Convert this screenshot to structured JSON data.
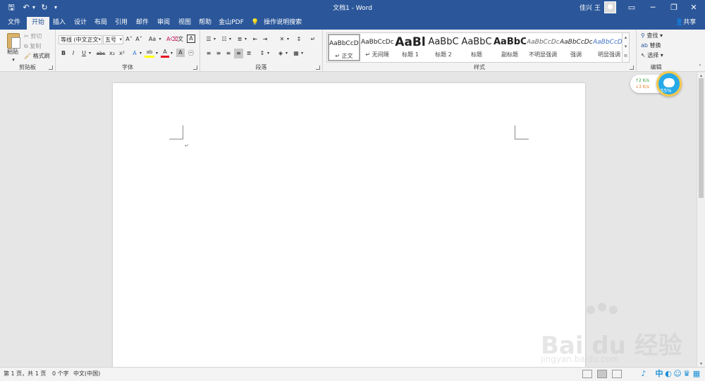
{
  "window": {
    "title": "文档1 - Word",
    "user": "佳兴 王",
    "qat": {
      "save": "🖫",
      "undo": "↶",
      "redo": "↻",
      "customize": "▾"
    },
    "controls": {
      "display_options": "▭",
      "minimize": "─",
      "restore": "❐",
      "close": "✕"
    }
  },
  "tabs": [
    "文件",
    "开始",
    "插入",
    "设计",
    "布局",
    "引用",
    "邮件",
    "审阅",
    "视图",
    "帮助",
    "金山PDF"
  ],
  "active_tab": "开始",
  "tell_me": "操作说明搜索",
  "share": "共享",
  "ribbon": {
    "clipboard": {
      "label": "剪贴板",
      "paste": "粘贴",
      "cut": "剪切",
      "copy": "复制",
      "format_painter": "格式刷"
    },
    "font": {
      "label": "字体",
      "font_name": "等线 (中文正文",
      "font_size": "五号",
      "grow": "A˄",
      "shrink": "A˅",
      "change_case": "Aa",
      "clear_format": "A⌫",
      "phonetic": "文",
      "border": "A",
      "bold": "B",
      "italic": "I",
      "underline": "U",
      "strike": "abc",
      "subscript": "x₂",
      "superscript": "x²",
      "text_effect": "A",
      "highlight": "ab",
      "font_color": "A",
      "char_shading": "A",
      "enclose": "㊀"
    },
    "paragraph": {
      "label": "段落",
      "bullets": "☰",
      "numbering": "☷",
      "multilevel": "≣",
      "dec_indent": "⇤",
      "inc_indent": "⇥",
      "chinese_layout": "✕",
      "sort": "↕",
      "show_marks": "↵",
      "align_left": "≡",
      "center": "≡",
      "align_right": "≡",
      "justify": "≡",
      "distributed": "≣",
      "line_spacing": "↕",
      "shading": "◈",
      "borders": "▦"
    },
    "styles": {
      "label": "样式",
      "items": [
        {
          "sample": "AaBbCcDc",
          "name": "正文"
        },
        {
          "sample": "AaBbCcDc",
          "name": "无间隔"
        },
        {
          "sample": "AaBl",
          "name": "标题 1"
        },
        {
          "sample": "AaBbC",
          "name": "标题 2"
        },
        {
          "sample": "AaBbC",
          "name": "标题"
        },
        {
          "sample": "AaBbC",
          "name": "副标题"
        },
        {
          "sample": "AaBbCcDc",
          "name": "不明显强调"
        },
        {
          "sample": "AaBbCcDc",
          "name": "强调"
        },
        {
          "sample": "AaBbCcDc",
          "name": "明显强调"
        }
      ],
      "selected_index": 0
    },
    "editing": {
      "label": "编辑",
      "find": "查找",
      "replace": "替换",
      "select": "选择"
    }
  },
  "document": {
    "paragraph_mark": "↵"
  },
  "speed_widget": {
    "up": "↑2  K/s",
    "down": "↓3  K/s",
    "percent": "55%"
  },
  "status": {
    "page": "第 1 页，共 1 页",
    "words": "0 个字",
    "language": "中文(中国)"
  },
  "tray": {
    "ime": "中",
    "items": [
      "♪",
      "◐",
      "☺",
      "♛",
      "▦"
    ]
  },
  "watermark": {
    "brand": "Bai  du 经验",
    "url": "jingyan.baidu.com"
  },
  "colors": {
    "accent": "#2b579a",
    "ribbon_bg": "#f3f3f3",
    "canvas_bg": "#e6e6e6",
    "highlight_yellow": "#ffff00",
    "font_red": "#e81123"
  }
}
